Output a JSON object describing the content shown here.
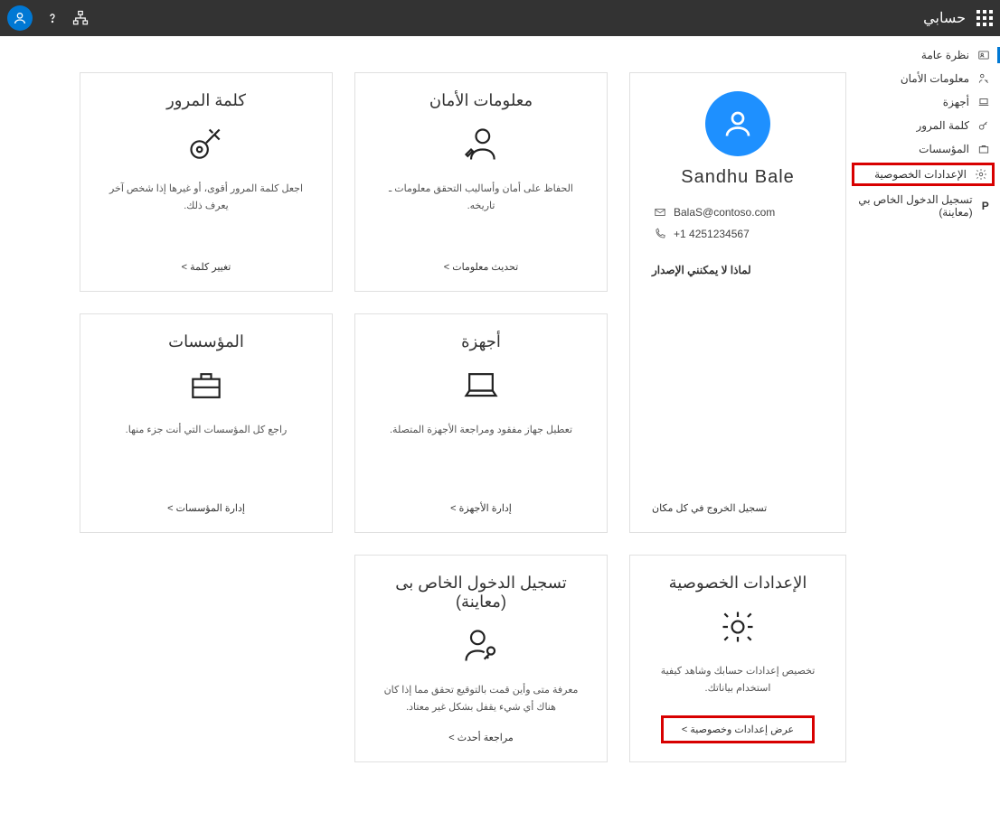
{
  "topbar": {
    "title": "حسابي"
  },
  "sidebar": {
    "overview": "نظرة عامة",
    "security": "معلومات الأمان",
    "devices": "أجهزة",
    "password": "كلمة المرور",
    "orgs": "المؤسسات",
    "privacy": "الإعدادات الخصوصية",
    "signins": "تسجيل الدخول الخاص بي (معاينة)"
  },
  "profile": {
    "name": "Sandhu  Bale",
    "email": "BalaS@contoso.com",
    "phone": "+1 4251234567",
    "why": "لماذا لا يمكنني الإصدار",
    "signout": "تسجيل الخروج في كل مكان"
  },
  "cards": {
    "security": {
      "title": "معلومات الأمان",
      "desc": "الحفاظ على أمان وأساليب التحقق معلومات ـ تاريخه.",
      "link": "تحديث معلومات &gt;"
    },
    "password": {
      "title": "كلمة المرور",
      "desc": "اجعل كلمة المرور أقوى، أو غيرها إذا شخص آخر يعرف ذلك.",
      "link": "تغيير كلمة &gt;"
    },
    "devices": {
      "title": "أجهزة",
      "desc": "تعطيل جهاز مفقود ومراجعة الأجهزة المتصلة.",
      "link": "إدارة الأجهزة &gt;"
    },
    "orgs": {
      "title": "المؤسسات",
      "desc": "راجع كل المؤسسات التي أنت جزء منها.",
      "link": "إدارة المؤسسات &gt;"
    },
    "privacy": {
      "title": "الإعدادات الخصوصية",
      "desc": "تخصيص إعدادات حسابك وشاهد كيفية استخدام بياناتك.",
      "link": "عرض إعدادات وخصوصية &gt;"
    },
    "signins": {
      "title": "تسجيل الدخول الخاص بى (معاينة)",
      "desc": "معرفة متى وأين قمت بالتوقيع تحقق مما إذا كان هناك أي شيء يقفل بشكل غير معتاد.",
      "link": "مراجعة أحدث &gt;"
    }
  }
}
